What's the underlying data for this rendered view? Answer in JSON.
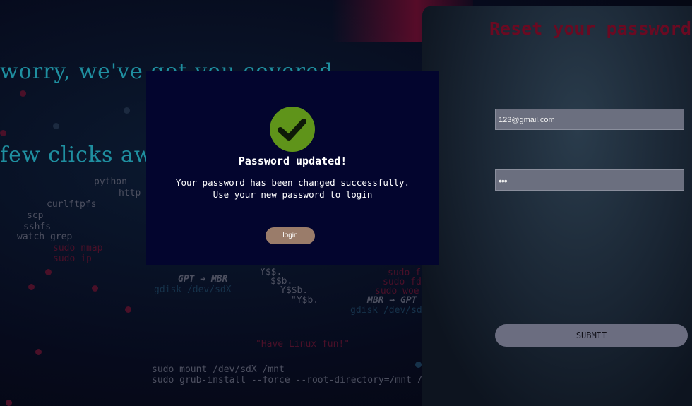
{
  "background": {
    "headline_1": "worry, we've got you covered",
    "headline_2": "few clicks away",
    "terminal_lines": {
      "python": "python",
      "http": "http",
      "curlftpfs": "curlftpfs",
      "scp": "scp",
      "sshfs": "sshfs",
      "watch_grep": "watch grep",
      "sudo_nmap": "sudo nmap",
      "sudo_ip": "sudo ip",
      "gpt_mbr_1": "GPT → MBR",
      "gdisk": "gdisk /dev/sdX",
      "yss_1": "Y$$.",
      "ssb": "$$b.",
      "yssb": "Y$$b.",
      "yssb2": "\"Y$b.",
      "mbr_gpt": "MBR → GPT",
      "gdisk2": "gdisk /dev/sd",
      "sudo_f": "sudo f",
      "sudo_fd": "sudo fd",
      "sudo_woe": "sudo woe",
      "happy": "\"Have Linux fun!\"",
      "sudo_mount": "sudo mount /dev/sdX /mnt",
      "sudo_grub": "sudo grub-install --force --root-directory=/mnt /"
    }
  },
  "modal": {
    "icon": "check-icon",
    "title": "Password updated!",
    "line_1": "Your password has been changed successfully.",
    "line_2": "Use your new password to login",
    "login_label": "login",
    "colors": {
      "background": "#03052e",
      "check": "#5f941a",
      "button": "#9a7c6a"
    }
  },
  "reset_panel": {
    "title": "Reset your password",
    "email_value": "123@gmail.com",
    "password_value": "•••",
    "submit_label": "SUBMIT",
    "colors": {
      "title": "#6a0a22",
      "field": "#6b6f7f",
      "submit": "#6b6d80"
    }
  }
}
